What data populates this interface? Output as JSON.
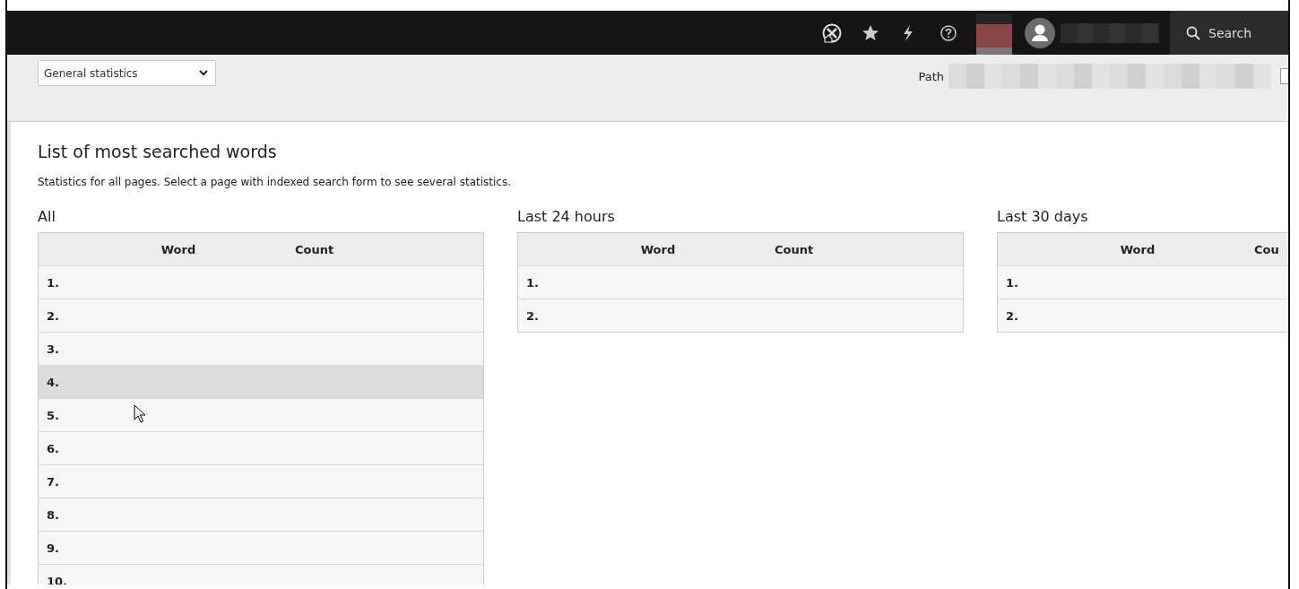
{
  "topbar": {
    "search_label": "Search"
  },
  "toolbar": {
    "select": {
      "value": "General statistics"
    },
    "path_label": "Path"
  },
  "content": {
    "title": "List of most searched words",
    "description": "Statistics for all pages. Select a page with indexed search form to see several statistics.",
    "tables": [
      {
        "heading": "All",
        "columns": [
          "Word",
          "Count"
        ],
        "rows": [
          {
            "rank": "1.",
            "hovered": false
          },
          {
            "rank": "2.",
            "hovered": false
          },
          {
            "rank": "3.",
            "hovered": false
          },
          {
            "rank": "4.",
            "hovered": true
          },
          {
            "rank": "5.",
            "hovered": false
          },
          {
            "rank": "6.",
            "hovered": false
          },
          {
            "rank": "7.",
            "hovered": false
          },
          {
            "rank": "8.",
            "hovered": false
          },
          {
            "rank": "9.",
            "hovered": false
          },
          {
            "rank": "10.",
            "hovered": false
          }
        ]
      },
      {
        "heading": "Last 24 hours",
        "columns": [
          "Word",
          "Count"
        ],
        "rows": [
          {
            "rank": "1.",
            "hovered": false
          },
          {
            "rank": "2.",
            "hovered": false
          }
        ]
      },
      {
        "heading": "Last 30 days",
        "columns": [
          "Word",
          "Cou"
        ],
        "rows": [
          {
            "rank": "1.",
            "hovered": false
          },
          {
            "rank": "2.",
            "hovered": false
          }
        ]
      }
    ]
  }
}
